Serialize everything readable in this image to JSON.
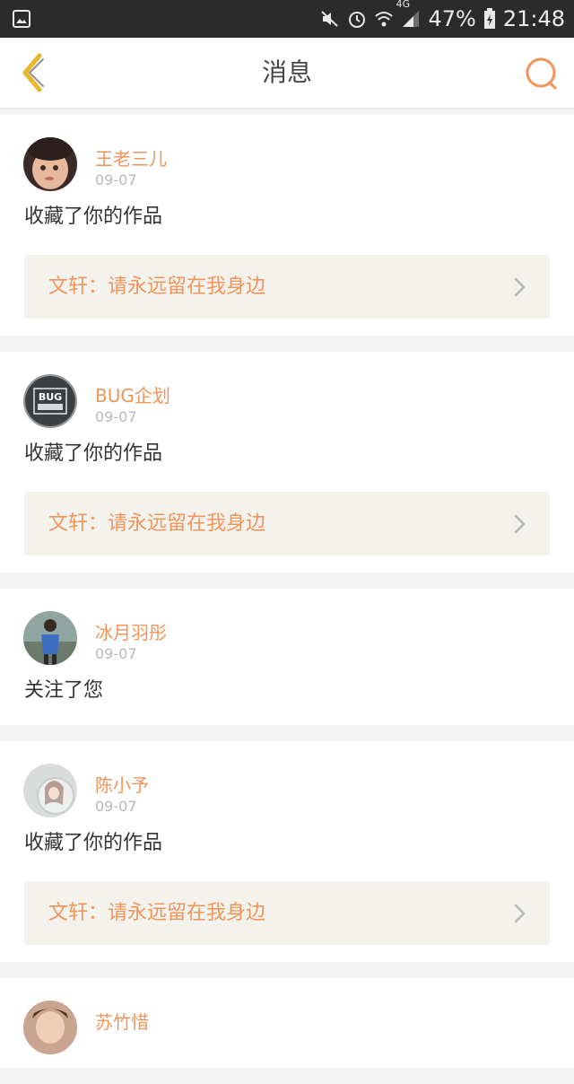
{
  "status_bar": {
    "battery": "47%",
    "network": "4G",
    "time": "21:48"
  },
  "navbar": {
    "title": "消息"
  },
  "colors": {
    "accent": "#f0955a",
    "back_icon": "#e6b62c",
    "link_bg": "#f3f2ed"
  },
  "messages": [
    {
      "username": "王老三儿",
      "date": "09-07",
      "action": "收藏了你的作品",
      "work": "文轩：请永远留在我身边",
      "avatar_icon": "child-photo-avatar"
    },
    {
      "username": "BUG企划",
      "date": "09-07",
      "action": "收藏了你的作品",
      "work": "文轩：请永远留在我身边",
      "avatar_icon": "bug-logo-avatar",
      "avatar_text": "BUG"
    },
    {
      "username": "冰月羽彤",
      "date": "09-07",
      "action": "关注了您",
      "avatar_icon": "person-outdoor-avatar"
    },
    {
      "username": "陈小予",
      "date": "09-07",
      "action": "收藏了你的作品",
      "work": "文轩：请永远留在我身边",
      "avatar_icon": "girl-photo-avatar"
    },
    {
      "username": "苏竹惜",
      "avatar_icon": "photo-avatar"
    }
  ]
}
